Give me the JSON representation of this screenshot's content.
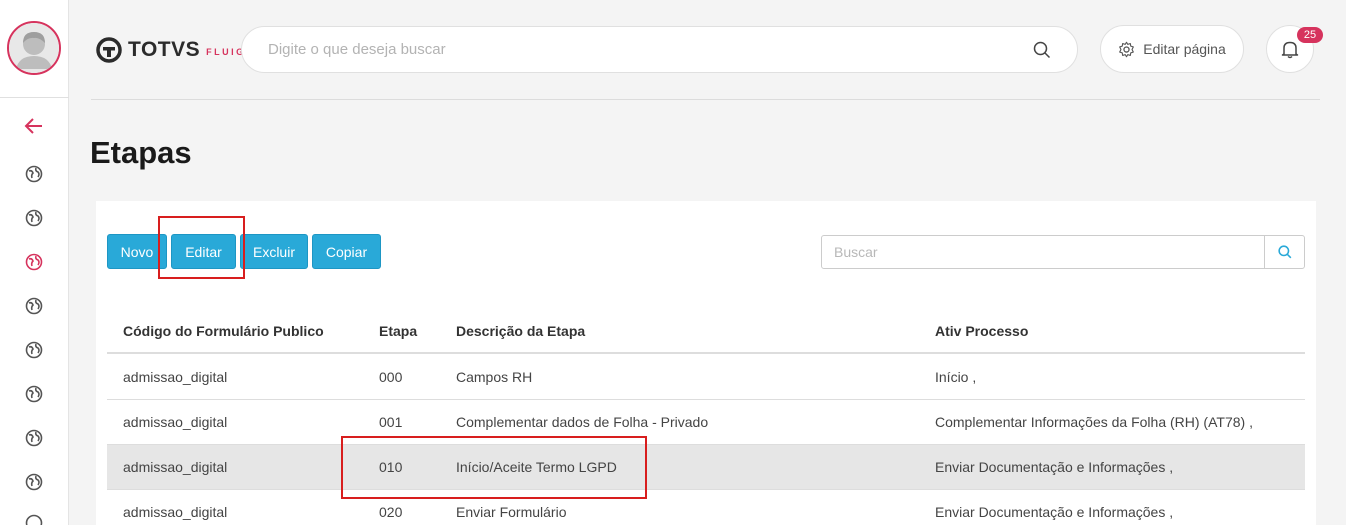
{
  "header": {
    "brand": "TOTVS",
    "brand_sub": "FLUIG",
    "search_placeholder": "Digite o que deseja buscar",
    "edit_page_label": "Editar página",
    "notification_count": "25"
  },
  "page": {
    "title": "Etapas"
  },
  "toolbar": {
    "buttons": [
      {
        "label": "Novo"
      },
      {
        "label": "Editar"
      },
      {
        "label": "Excluir"
      },
      {
        "label": "Copiar"
      }
    ],
    "search_placeholder": "Buscar"
  },
  "table": {
    "columns": [
      "Código do Formulário Publico",
      "Etapa",
      "Descrição da Etapa",
      "Ativ Processo"
    ],
    "rows": [
      {
        "codigo": "admissao_digital",
        "etapa": "000",
        "descricao": "Campos RH",
        "ativ": "Início ,"
      },
      {
        "codigo": "admissao_digital",
        "etapa": "001",
        "descricao": "Complementar dados de Folha - Privado",
        "ativ": "Complementar Informações da Folha (RH) (AT78) ,"
      },
      {
        "codigo": "admissao_digital",
        "etapa": "010",
        "descricao": "Início/Aceite Termo LGPD",
        "ativ": "Enviar Documentação e Informações ,"
      },
      {
        "codigo": "admissao_digital",
        "etapa": "020",
        "descricao": "Enviar Formulário",
        "ativ": "Enviar Documentação e Informações ,"
      }
    ],
    "selected_row": 2
  },
  "colors": {
    "accent": "#d6335d",
    "button": "#29a9d8",
    "annotation": "#d81e1e"
  }
}
